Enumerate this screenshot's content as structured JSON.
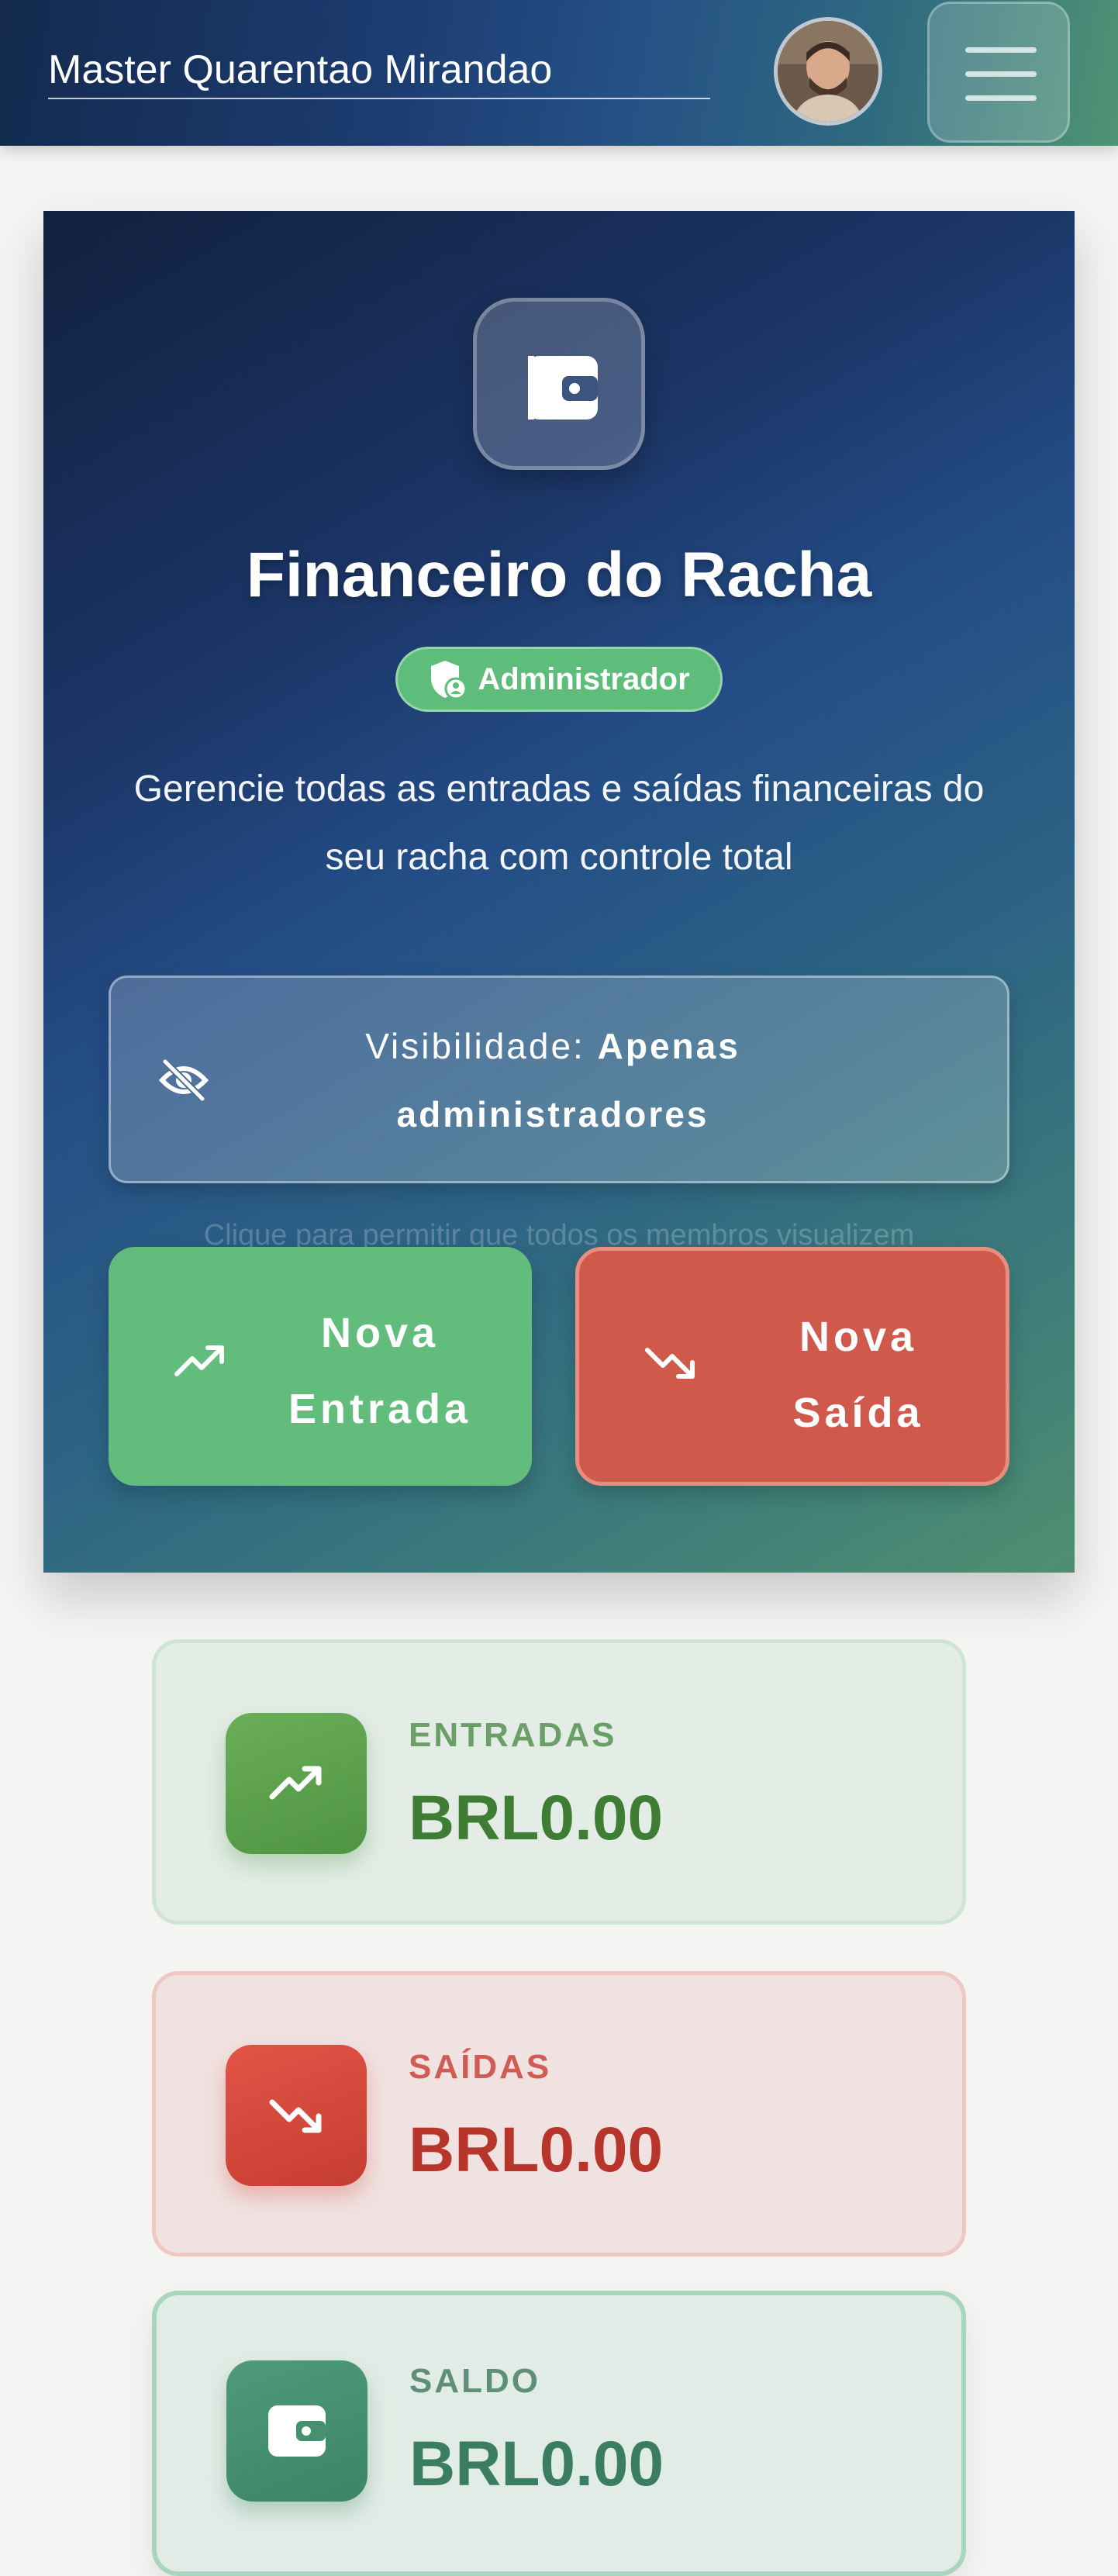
{
  "header": {
    "user_name": "Master Quarentao Mirandao"
  },
  "hero": {
    "title": "Financeiro do Racha",
    "badge": "Administrador",
    "description": "Gerencie todas as entradas e saídas financeiras do seu racha com controle total",
    "visibility": {
      "label": "Visibilidade:",
      "value": "Apenas administradores",
      "hint": "Clique para permitir que todos os membros visualizem"
    },
    "buttons": {
      "entrada": "Nova Entrada",
      "saida": "Nova Saída"
    }
  },
  "stats": {
    "entradas": {
      "label": "ENTRADAS",
      "value": "BRL0.00"
    },
    "saidas": {
      "label": "SAÍDAS",
      "value": "BRL0.00"
    },
    "saldo": {
      "label": "SALDO",
      "value": "BRL0.00"
    }
  },
  "colors": {
    "accent_green": "#62bc7c",
    "accent_red": "#cf5a4c",
    "header_dark": "#142a4e"
  },
  "icons": [
    "avatar-photo",
    "menu-icon",
    "wallet-icon",
    "shield-user-icon",
    "eye-off-icon",
    "trending-up-icon",
    "trending-down-icon"
  ]
}
